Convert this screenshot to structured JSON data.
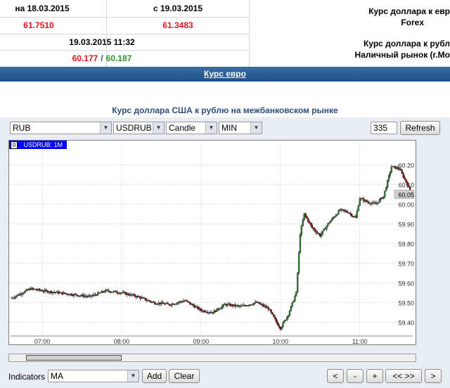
{
  "rates_table": {
    "date_left": "на 18.03.2015",
    "date_right": "с 19.03.2015",
    "value_left": "61.7510",
    "value_right": "61.3483",
    "timestamp": "19.03.2015 11:32",
    "bid": "60.177",
    "separator": "/",
    "ask": "60.187"
  },
  "right_labels": {
    "usd_eur": "Курс доллара к евр",
    "forex": "Forex",
    "usd_rub": "Курс доллара к рубл",
    "cash_market": "Наличный рынок (г.Мо"
  },
  "euro_link": "Курс евро",
  "chart_title": "Курс доллара США к рублю на межбанковском рынке",
  "controls": {
    "currency": "RUB",
    "pair": "USDRUB",
    "chart_type": "Candle",
    "interval": "MIN",
    "count": "335",
    "refresh_label": "Refresh",
    "indicators_label": "Indicators",
    "indicator_value": "MA",
    "add_label": "Add",
    "clear_label": "Clear",
    "nav_prev": "<",
    "nav_minus": "-",
    "nav_plus": "+",
    "nav_expand": "<< >>",
    "nav_next": ">"
  },
  "legend": {
    "marker": "0",
    "text": "USDRUB: 1M"
  },
  "current_price_label": "60.05",
  "chart_data": {
    "type": "candlestick",
    "series_name": "USDRUB: 1M",
    "xlabel": "",
    "ylabel": "",
    "x_ticks": [
      "07:00",
      "08:00",
      "09:00",
      "10:00",
      "11:00"
    ],
    "y_ticks": [
      "59.40",
      "59.50",
      "59.60",
      "59.70",
      "59.80",
      "59.90",
      "60.00",
      "60.10",
      "60.20"
    ],
    "ylim": [
      59.33,
      60.28
    ],
    "x_range_hours": [
      6.6,
      11.65
    ],
    "grid": "dotted",
    "up_color": "#2e7d32",
    "down_color": "#8b0000",
    "current_price": 60.05,
    "price_path": [
      [
        6.6,
        59.52
      ],
      [
        6.75,
        59.55
      ],
      [
        6.85,
        59.57
      ],
      [
        7.0,
        59.56
      ],
      [
        7.2,
        59.55
      ],
      [
        7.4,
        59.54
      ],
      [
        7.6,
        59.53
      ],
      [
        7.8,
        59.56
      ],
      [
        8.0,
        59.55
      ],
      [
        8.2,
        59.53
      ],
      [
        8.4,
        59.5
      ],
      [
        8.6,
        59.49
      ],
      [
        8.8,
        59.51
      ],
      [
        9.0,
        59.46
      ],
      [
        9.15,
        59.45
      ],
      [
        9.3,
        59.49
      ],
      [
        9.5,
        59.48
      ],
      [
        9.7,
        59.5
      ],
      [
        9.85,
        59.47
      ],
      [
        9.95,
        59.4
      ],
      [
        10.0,
        59.37
      ],
      [
        10.1,
        59.44
      ],
      [
        10.2,
        59.55
      ],
      [
        10.25,
        59.85
      ],
      [
        10.3,
        59.95
      ],
      [
        10.4,
        59.88
      ],
      [
        10.5,
        59.84
      ],
      [
        10.6,
        59.9
      ],
      [
        10.75,
        59.97
      ],
      [
        10.85,
        59.96
      ],
      [
        10.95,
        59.93
      ],
      [
        11.0,
        60.03
      ],
      [
        11.1,
        60.01
      ],
      [
        11.2,
        60.0
      ],
      [
        11.3,
        60.04
      ],
      [
        11.4,
        60.19
      ],
      [
        11.5,
        60.18
      ],
      [
        11.6,
        60.1
      ],
      [
        11.65,
        60.05
      ]
    ]
  }
}
